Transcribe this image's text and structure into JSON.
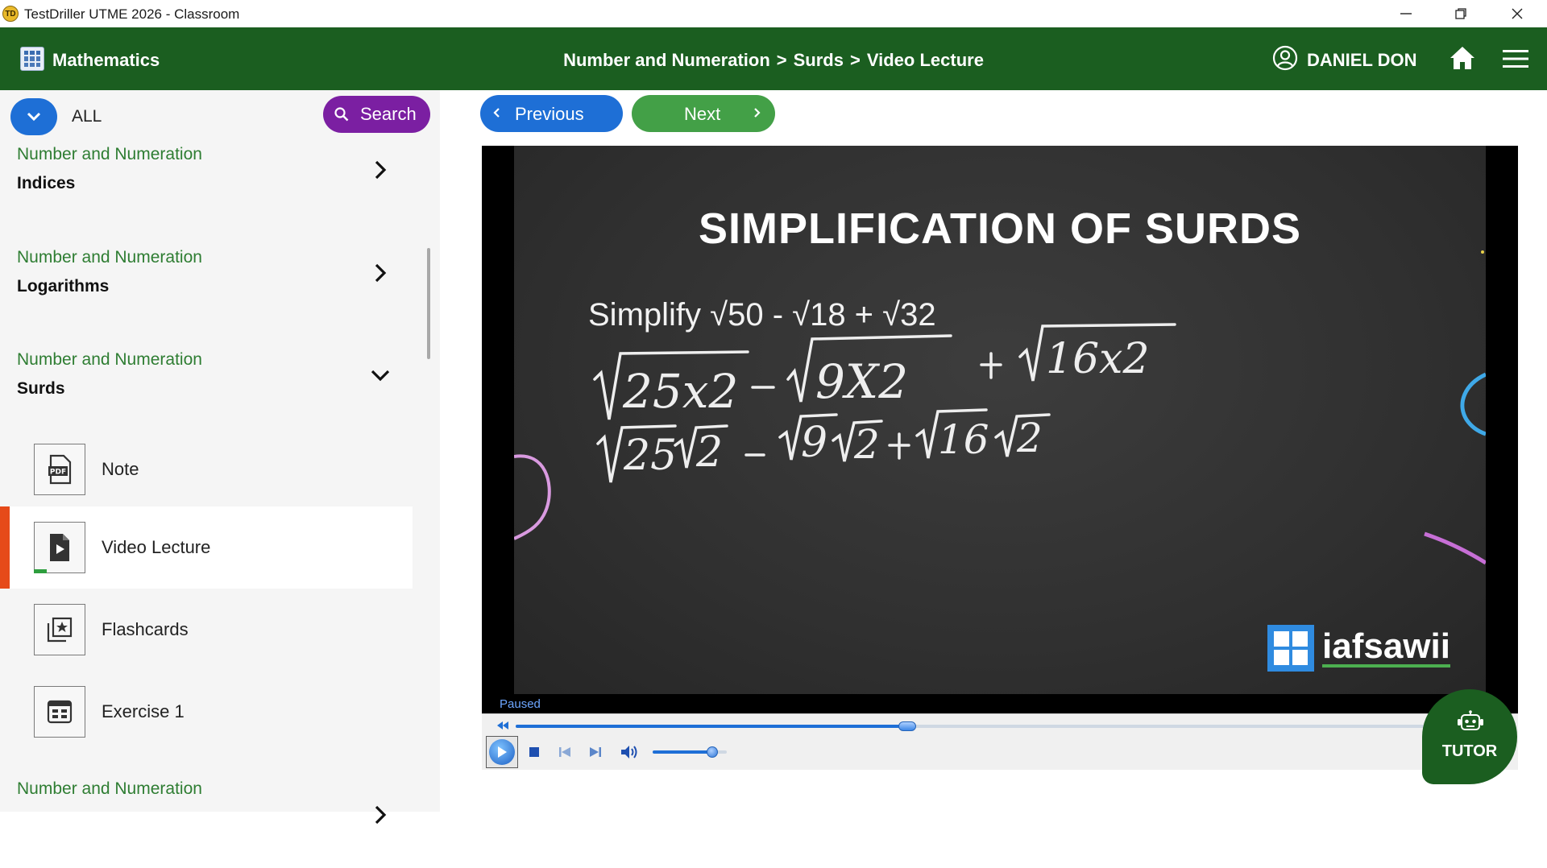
{
  "window": {
    "title": "TestDriller UTME 2026 - Classroom",
    "app_icon_text": "TD"
  },
  "header": {
    "subject": "Mathematics",
    "breadcrumb": [
      "Number and Numeration",
      "Surds",
      "Video Lecture"
    ],
    "breadcrumb_separator": ">",
    "user_name": "DANIEL DON"
  },
  "sidebar": {
    "filter_label": "ALL",
    "search_label": "Search",
    "topics": [
      {
        "subject": "Number and Numeration",
        "name": "Indices",
        "expanded": false
      },
      {
        "subject": "Number and Numeration",
        "name": "Logarithms",
        "expanded": false
      },
      {
        "subject": "Number and Numeration",
        "name": "Surds",
        "expanded": true
      },
      {
        "subject": "Number and Numeration",
        "name": "",
        "expanded": false
      }
    ],
    "lessons": [
      {
        "label": "Note",
        "icon": "pdf-icon",
        "active": false
      },
      {
        "label": "Video Lecture",
        "icon": "video-file-icon",
        "active": true,
        "progress": 0.25
      },
      {
        "label": "Flashcards",
        "icon": "flashcards-icon",
        "active": false
      },
      {
        "label": "Exercise 1",
        "icon": "exercise-icon",
        "active": false
      }
    ]
  },
  "nav": {
    "previous_label": "Previous",
    "next_label": "Next"
  },
  "video": {
    "title": "SIMPLIFICATION OF SURDS",
    "problem": "Simplify √50 - √18 + √32",
    "brand": "iafsawii",
    "status": "Paused",
    "seek_progress": 0.405,
    "volume": 0.8
  },
  "tutor": {
    "label": "TUTOR"
  },
  "colors": {
    "header_green": "#1b5e20",
    "primary_blue": "#1e6fd6",
    "next_green": "#43a047",
    "search_purple": "#7b1fa2",
    "active_marker": "#e64a19",
    "topic_green": "#2e7d32"
  }
}
